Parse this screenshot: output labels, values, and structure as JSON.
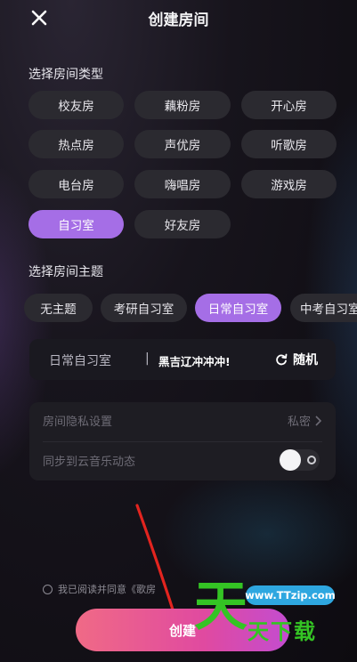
{
  "header": {
    "title": "创建房间",
    "close_icon": "close-icon"
  },
  "room_type": {
    "label": "选择房间类型",
    "options": [
      "校友房",
      "藕粉房",
      "开心房",
      "热点房",
      "声优房",
      "听歌房",
      "电台房",
      "嗨唱房",
      "游戏房",
      "自习室",
      "好友房"
    ],
    "selected": "自习室"
  },
  "room_theme": {
    "label": "选择房间主题",
    "options": [
      "无主题",
      "考研自习室",
      "日常自习室",
      "中考自习室"
    ],
    "selected": "日常自习室"
  },
  "room_name": {
    "prefix": "日常自习室",
    "separator": "|",
    "value": "黑吉辽冲冲冲!",
    "random_label": "随机",
    "random_icon": "refresh-icon"
  },
  "settings": {
    "privacy_label": "房间隐私设置",
    "privacy_value": "私密",
    "sync_label": "同步到云音乐动态",
    "sync_enabled": false
  },
  "agreement": {
    "text": "我已阅读并同意《歌房"
  },
  "create_button": {
    "label": "创建"
  },
  "watermark": {
    "url": "www.TTzip.com",
    "big_char": "天",
    "small_text": "天下载"
  },
  "colors": {
    "accent": "#a56ee6",
    "chip_bg": "#2b2a30",
    "button_start": "#f06a86",
    "button_end": "#c34cd0",
    "watermark_green": "#34c424",
    "watermark_blue": "#2ea7e0",
    "arrow_red": "#e3241f"
  }
}
